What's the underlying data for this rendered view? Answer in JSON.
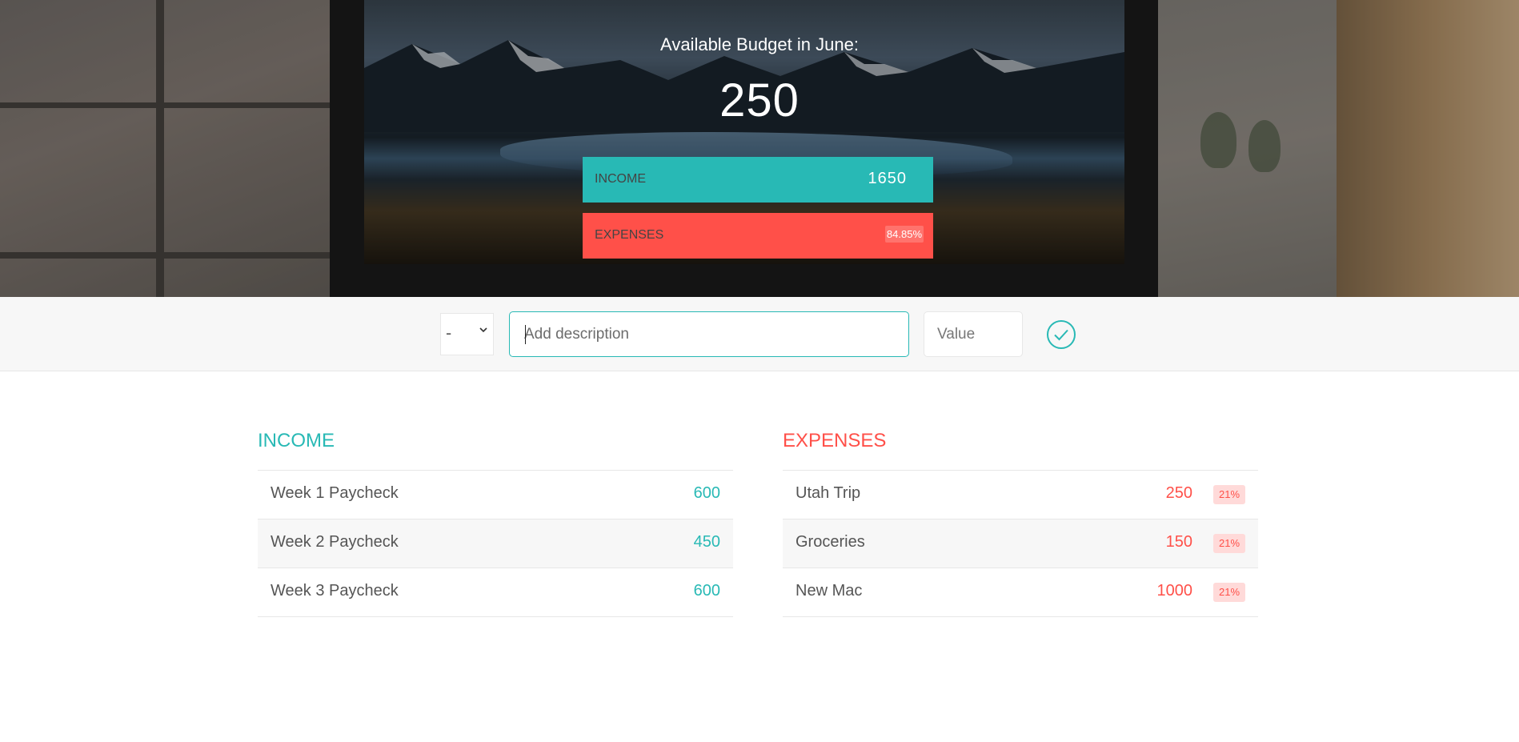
{
  "header": {
    "title": "Available Budget in June:",
    "budget": "250",
    "income_label": "INCOME",
    "income_value": "1650",
    "expenses_label": "EXPENSES",
    "expenses_percentage": "84.85%"
  },
  "add_bar": {
    "type_value": "-",
    "description_placeholder": "Add description",
    "value_placeholder": "Value",
    "submit_icon": "checkmark-circle-icon"
  },
  "income": {
    "title": "INCOME",
    "items": [
      {
        "description": "Week 1 Paycheck",
        "value": "600"
      },
      {
        "description": "Week 2 Paycheck",
        "value": "450"
      },
      {
        "description": "Week 3 Paycheck",
        "value": "600"
      }
    ]
  },
  "expenses": {
    "title": "EXPENSES",
    "items": [
      {
        "description": "Utah Trip",
        "value": "250",
        "percentage": "21%"
      },
      {
        "description": "Groceries",
        "value": "150",
        "percentage": "21%"
      },
      {
        "description": "New Mac",
        "value": "1000",
        "percentage": "21%"
      }
    ]
  },
  "colors": {
    "income": "#28b9b5",
    "expenses": "#ff5049"
  }
}
